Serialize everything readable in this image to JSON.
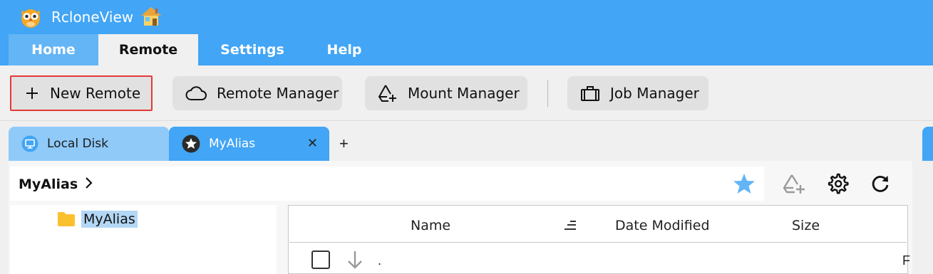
{
  "app": {
    "title": "RcloneView"
  },
  "menu": {
    "tabs": [
      "Home",
      "Remote",
      "Settings",
      "Help"
    ],
    "active": "Remote"
  },
  "toolbar": {
    "new_remote": "New Remote",
    "remote_manager": "Remote Manager",
    "mount_manager": "Mount Manager",
    "job_manager": "Job Manager"
  },
  "tabs": [
    {
      "label": "Local Disk",
      "icon": "monitor-icon"
    },
    {
      "label": "MyAlias",
      "icon": "star-badge-icon",
      "close": "✕"
    }
  ],
  "add_tab": "+",
  "path": {
    "label": "MyAlias"
  },
  "tree": {
    "items": [
      {
        "label": "MyAlias",
        "icon": "folder-icon"
      }
    ]
  },
  "filelist": {
    "columns": {
      "name": "Name",
      "date": "Date Modified",
      "size": "Size"
    },
    "rows": [
      {
        "name": ".",
        "trailing": "F"
      }
    ]
  },
  "colors": {
    "accent": "#42a5f5",
    "accent_light": "#90caf9",
    "highlight": "#e53935",
    "star": "#64b5f6"
  }
}
